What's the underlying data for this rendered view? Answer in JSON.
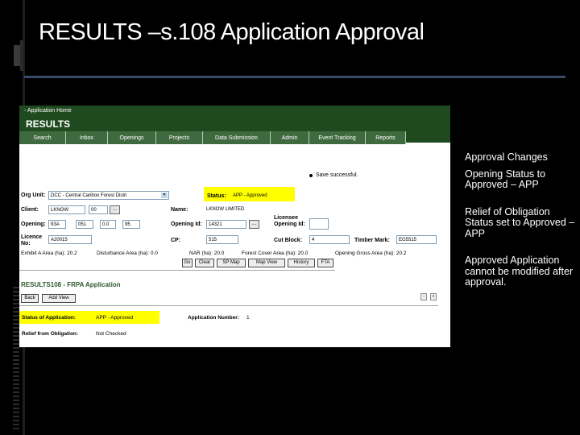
{
  "slide": {
    "title": "RESULTS –s.108 Application Approval"
  },
  "app": {
    "home_link": "- Application Home",
    "name": "RESULTS",
    "nav": [
      {
        "label": "Search",
        "w": 58
      },
      {
        "label": "Inbox",
        "w": 52
      },
      {
        "label": "Openings",
        "w": 60
      },
      {
        "label": "Projects",
        "w": 58
      },
      {
        "label": "Data Submission",
        "w": 84
      },
      {
        "label": "Admin",
        "w": 48
      },
      {
        "label": "Event Tracking",
        "w": 70
      },
      {
        "label": "Reports",
        "w": 50
      }
    ],
    "save_message": "Save successful.",
    "form": {
      "org_unit_label": "Org Unit:",
      "org_unit_value": "DCC - Central Cariboo Forest Distri",
      "status_label": "Status:",
      "status_value": "APP - Approved",
      "client_label": "Client:",
      "client_value": "LKNOW",
      "client_loc": "00",
      "name_label": "Name:",
      "name_value": "LKNOW LIMITED",
      "opening_label": "Opening:",
      "opening_1": "93A",
      "opening_2": "051",
      "opening_3": "0.0",
      "opening_4": "95",
      "opening_id_label": "Opening Id:",
      "opening_id_value": "14321",
      "licensee_opening_label": "Licensee Opening Id:",
      "licence_no_label": "Licence No:",
      "licence_no_value": "A20015",
      "cp_label": "CP:",
      "cp_value": "515",
      "cut_block_label": "Cut Block:",
      "cut_block_value": "4",
      "timber_mark_label": "Timber Mark:",
      "timber_mark_value": "EG5515",
      "exhibit_a": "Exhibit A Area (ha): 20.2",
      "disturbance": "Disturbance Area (ha): 0.0",
      "nar": "NAR (ha): 20.0",
      "forest_cover": "Forest Cover Area (ha): 20.0",
      "opening_gross": "Opening Gross Area (ha): 20.2"
    },
    "buttons": {
      "go": "Go",
      "clear": "Clear",
      "sp_map": "SP Map",
      "map_view": "Map View",
      "history": "History",
      "fta": "FTA"
    },
    "frpa": {
      "title": "RESULTS108 - FRPA Application",
      "back": "Back",
      "add_view": "Add View",
      "status_label": "Status of Application:",
      "status_value": "APP - Approved",
      "app_number_label": "Application Number:",
      "app_number_value": "1",
      "relief_label": "Relief from Obligation:",
      "relief_value": "Not Checked"
    }
  },
  "notes": [
    "Approval Changes",
    "Opening Status to Approved – APP",
    "Relief of Obligation Status set to Approved – APP",
    "Approved Application cannot be modified after approval."
  ]
}
